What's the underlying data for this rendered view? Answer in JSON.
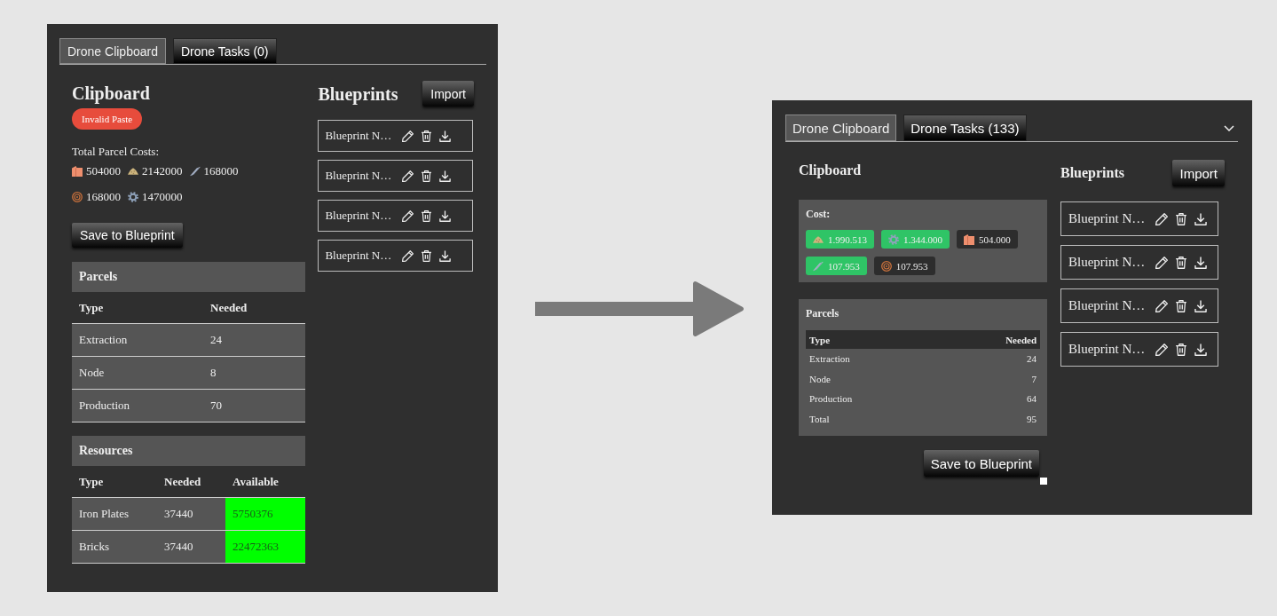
{
  "panels": [
    {
      "kind": "before",
      "tabs": [
        {
          "label": "Drone Clipboard",
          "selected": true
        },
        {
          "label": "Drone Tasks (0)",
          "selected": false
        }
      ],
      "clipboard": {
        "title": "Clipboard",
        "badge": "Invalid Paste",
        "costs_label": "Total Parcel Costs:",
        "costs": [
          {
            "kind": "brick",
            "value": "504000"
          },
          {
            "kind": "sand",
            "value": "2142000"
          },
          {
            "kind": "beam",
            "value": "168000"
          },
          {
            "kind": "coil",
            "value": "168000"
          },
          {
            "kind": "gear",
            "value": "1470000"
          }
        ],
        "save_button": "Save to Blueprint",
        "parcels": {
          "title": "Parcels",
          "columns": [
            "Type",
            "Needed"
          ],
          "rows": [
            {
              "cells": [
                "Extraction",
                "24"
              ]
            },
            {
              "cells": [
                "Node",
                "8"
              ]
            },
            {
              "cells": [
                "Production",
                "70"
              ]
            }
          ]
        },
        "resources": {
          "title": "Resources",
          "columns": [
            "Type",
            "Needed",
            "Available"
          ],
          "rows": [
            {
              "cells": [
                "Iron Plates",
                "37440",
                "5750376"
              ],
              "sufficient": true
            },
            {
              "cells": [
                "Bricks",
                "37440",
                "22472363"
              ],
              "sufficient": true
            }
          ]
        }
      },
      "blueprints": {
        "title": "Blueprints",
        "import_button": "Import",
        "items": [
          "Blueprint N…",
          "Blueprint N…",
          "Blueprint N…",
          "Blueprint N…"
        ]
      }
    },
    {
      "kind": "after",
      "tabs": [
        {
          "label": "Drone Clipboard",
          "selected": true
        },
        {
          "label": "Drone Tasks (133)",
          "selected": false
        }
      ],
      "clipboard": {
        "title": "Clipboard",
        "costs_label": "Cost:",
        "costs": [
          {
            "kind": "sand",
            "value": "1.990.513",
            "sufficient": true
          },
          {
            "kind": "gear",
            "value": "1.344.000",
            "sufficient": true
          },
          {
            "kind": "brick",
            "value": "504.000",
            "sufficient": false
          },
          {
            "kind": "beam",
            "value": "107.953",
            "sufficient": true
          },
          {
            "kind": "coil",
            "value": "107.953",
            "sufficient": false
          }
        ],
        "parcels": {
          "title": "Parcels",
          "columns": [
            "Type",
            "Needed"
          ],
          "rows": [
            {
              "cells": [
                "Extraction",
                "24"
              ]
            },
            {
              "cells": [
                "Node",
                "7"
              ]
            },
            {
              "cells": [
                "Production",
                "64"
              ]
            },
            {
              "cells": [
                "Total",
                "95"
              ]
            }
          ]
        },
        "save_button": "Save to Blueprint"
      },
      "blueprints": {
        "title": "Blueprints",
        "import_button": "Import",
        "items": [
          "Blueprint N…",
          "Blueprint N…",
          "Blueprint N…",
          "Blueprint N…"
        ]
      }
    }
  ]
}
